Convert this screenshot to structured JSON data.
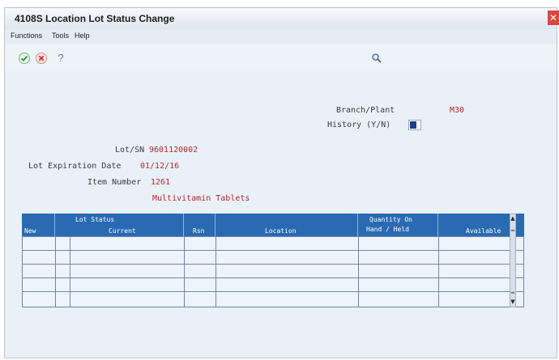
{
  "window": {
    "title": "4108S  Location Lot Status Change"
  },
  "menu": [
    "Functions",
    "Tools",
    "Help"
  ],
  "toolbar": {
    "ok_icon": "check-icon",
    "cancel_icon": "x-icon",
    "help_icon": "question-icon",
    "search_icon": "magnifier-icon"
  },
  "form": {
    "branch_plant_label": "Branch/Plant",
    "branch_plant_value": "M30",
    "history_label": "History (Y/N)",
    "history_value": "N",
    "lot_sn_label": "Lot/SN",
    "lot_sn_value": "9601120002",
    "lot_exp_label": "Lot Expiration Date",
    "lot_exp_value": "01/12/16",
    "item_number_label": "Item Number",
    "item_number_value": "1261",
    "item_desc": "Multivitamin Tablets"
  },
  "grid": {
    "headers": {
      "new": "New",
      "lot_status_top": "Lot Status",
      "current": "Current",
      "rsn": "Rsn",
      "location": "Location",
      "qty_top": "Quantity On",
      "qty_bottom": "Hand / Held",
      "available": "Available"
    },
    "rows": [
      "",
      "",
      "",
      "",
      ""
    ]
  },
  "colors": {
    "header_blue": "#2a6ab3",
    "value_red": "#b02a2a"
  }
}
